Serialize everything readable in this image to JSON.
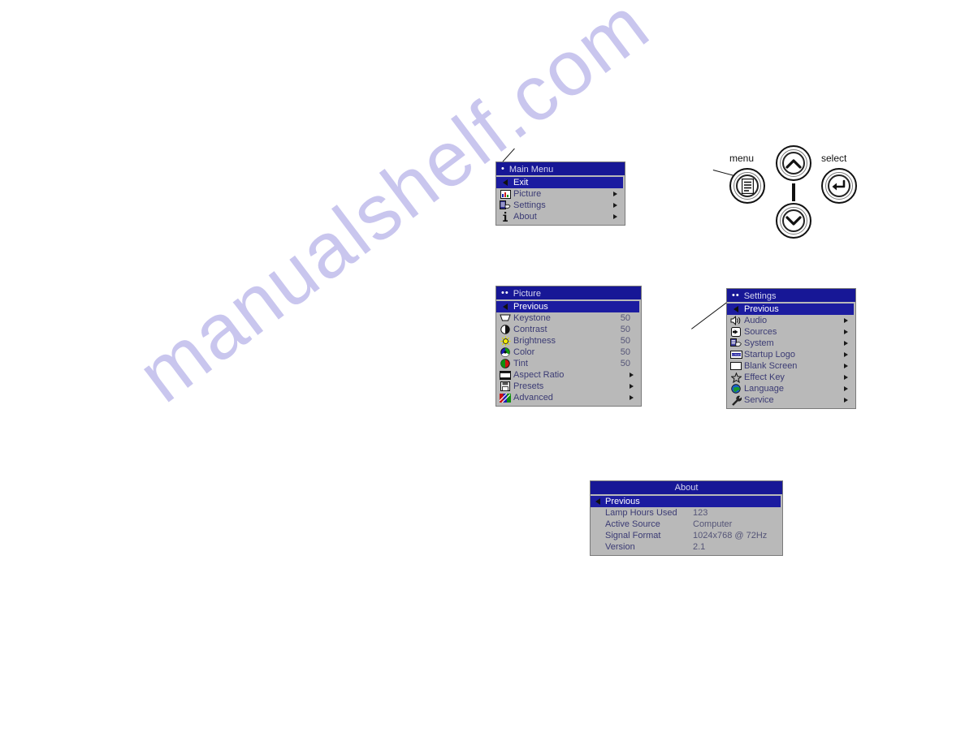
{
  "page": {
    "watermark": "manualshelf.com",
    "background_color": "#ffffff",
    "menu_bg": "#b9b9b9",
    "menu_title_bg": "#171796",
    "menu_highlight_bg": "#1c1ca0"
  },
  "main_menu": {
    "title": "Main Menu",
    "title_dots": "•",
    "items": [
      {
        "label": "Exit",
        "icon": "back-arrow-icon",
        "selected": true,
        "arrow": false
      },
      {
        "label": "Picture",
        "icon": "picture-icon",
        "selected": false,
        "arrow": true
      },
      {
        "label": "Settings",
        "icon": "settings-icon",
        "selected": false,
        "arrow": true
      },
      {
        "label": "About",
        "icon": "info-icon",
        "selected": false,
        "arrow": true
      }
    ]
  },
  "picture_menu": {
    "title": "Picture",
    "title_dots": "••",
    "items": [
      {
        "label": "Previous",
        "icon": "back-arrow-icon",
        "selected": true,
        "value": "",
        "arrow": false
      },
      {
        "label": "Keystone",
        "icon": "keystone-icon",
        "selected": false,
        "value": "50",
        "arrow": false
      },
      {
        "label": "Contrast",
        "icon": "contrast-icon",
        "selected": false,
        "value": "50",
        "arrow": false
      },
      {
        "label": "Brightness",
        "icon": "brightness-icon",
        "selected": false,
        "value": "50",
        "arrow": false
      },
      {
        "label": "Color",
        "icon": "color-icon",
        "selected": false,
        "value": "50",
        "arrow": false
      },
      {
        "label": "Tint",
        "icon": "tint-icon",
        "selected": false,
        "value": "50",
        "arrow": false
      },
      {
        "label": "Aspect Ratio",
        "icon": "aspect-ratio-icon",
        "selected": false,
        "value": "",
        "arrow": true
      },
      {
        "label": "Presets",
        "icon": "presets-icon",
        "selected": false,
        "value": "",
        "arrow": true
      },
      {
        "label": "Advanced",
        "icon": "advanced-icon",
        "selected": false,
        "value": "",
        "arrow": true
      }
    ]
  },
  "settings_menu": {
    "title": "Settings",
    "title_dots": "••",
    "items": [
      {
        "label": "Previous",
        "icon": "back-arrow-icon",
        "selected": true,
        "arrow": false
      },
      {
        "label": "Audio",
        "icon": "speaker-icon",
        "selected": false,
        "arrow": true
      },
      {
        "label": "Sources",
        "icon": "sources-icon",
        "selected": false,
        "arrow": true
      },
      {
        "label": "System",
        "icon": "system-icon",
        "selected": false,
        "arrow": true
      },
      {
        "label": "Startup Logo",
        "icon": "startup-logo-icon",
        "selected": false,
        "arrow": true
      },
      {
        "label": "Blank Screen",
        "icon": "blank-screen-icon",
        "selected": false,
        "arrow": true
      },
      {
        "label": "Effect Key",
        "icon": "star-icon",
        "selected": false,
        "arrow": true
      },
      {
        "label": "Language",
        "icon": "globe-icon",
        "selected": false,
        "arrow": true
      },
      {
        "label": "Service",
        "icon": "wrench-icon",
        "selected": false,
        "arrow": true
      }
    ]
  },
  "about_menu": {
    "title": "About",
    "items": [
      {
        "label": "Previous",
        "value": "",
        "selected": true
      },
      {
        "label": "Lamp Hours Used",
        "value": "123",
        "selected": false
      },
      {
        "label": "Active Source",
        "value": "Computer",
        "selected": false
      },
      {
        "label": "Signal Format",
        "value": "1024x768 @ 72Hz",
        "selected": false
      },
      {
        "label": "Version",
        "value": "2.1",
        "selected": false
      }
    ]
  },
  "controls": {
    "menu_label": "menu",
    "select_label": "select",
    "buttons": [
      {
        "name": "menu-button",
        "icon": "menu-list-icon"
      },
      {
        "name": "up-button",
        "icon": "chevron-up-icon"
      },
      {
        "name": "down-button",
        "icon": "chevron-down-icon"
      },
      {
        "name": "select-button",
        "icon": "enter-arrow-icon"
      }
    ]
  }
}
